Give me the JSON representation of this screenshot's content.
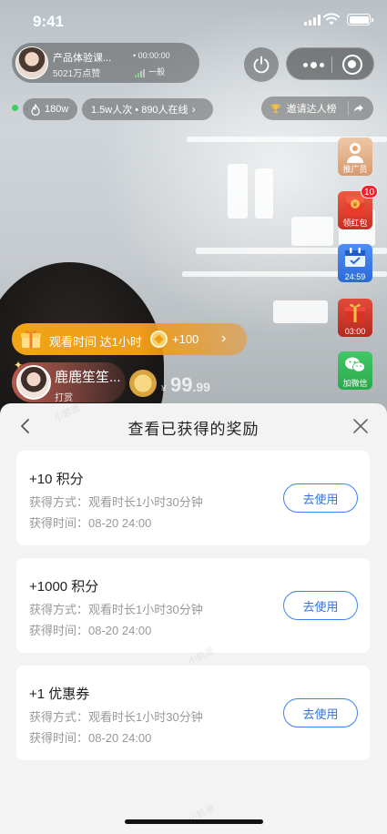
{
  "status_bar": {
    "time": "9:41"
  },
  "host": {
    "name": "产品体验课...",
    "likes": "5021万点赞",
    "timer": "• 00:00:00",
    "network": "一般"
  },
  "stats": {
    "heat": "180w",
    "viewers": "1.5w人次 • 890人在线",
    "invite_label": "邀请达人榜"
  },
  "side_buttons": [
    {
      "label": "推广员"
    },
    {
      "label": "领红包",
      "badge": "10"
    },
    {
      "label": "24:59"
    },
    {
      "label": "03:00"
    },
    {
      "label": "加微信"
    }
  ],
  "watch_task": {
    "title": "观看时间 达1小时",
    "points": "+100"
  },
  "tip": {
    "name": "鹿鹿笙笙...",
    "action": "打赏",
    "currency": "¥",
    "price_int": "99",
    "price_dec": ".99"
  },
  "sheet": {
    "title": "查看已获得的奖励",
    "rewards": [
      {
        "amount": "+10 积分",
        "method": "获得方式：观看时长1小时30分钟",
        "time": "获得时间：08-20 24:00",
        "button": "去使用"
      },
      {
        "amount": "+1000 积分",
        "method": "获得方式：观看时长1小时30分钟",
        "time": "获得时间：08-20 24:00",
        "button": "去使用"
      },
      {
        "amount": "+1 优惠券",
        "method": "获得方式：观看时长1小时30分钟",
        "time": "获得时间：08-20 24:00",
        "button": "去使用"
      }
    ]
  },
  "watermark": "小鹅通",
  "colors": {
    "accent_blue": "#2f73e0",
    "task_orange": "#f1a515",
    "badge_red": "#f5222d",
    "online_green": "#37d25c"
  }
}
